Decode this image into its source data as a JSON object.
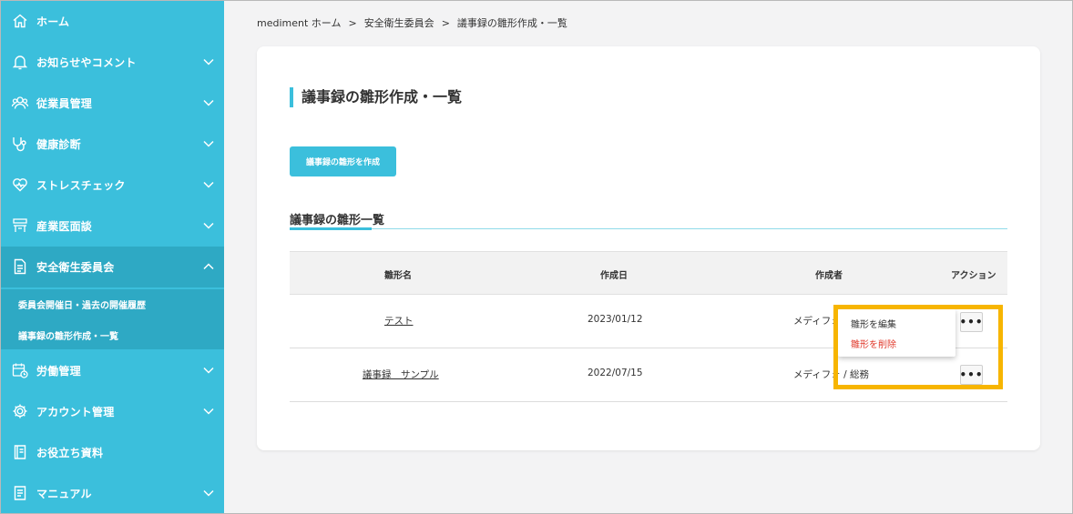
{
  "sidebar": {
    "items": [
      {
        "label": "ホーム",
        "icon": "home-icon",
        "chevron": ""
      },
      {
        "label": "お知らせやコメント",
        "icon": "bell-icon",
        "chevron": "down"
      },
      {
        "label": "従業員管理",
        "icon": "users-icon",
        "chevron": "down"
      },
      {
        "label": "健康診断",
        "icon": "stethoscope-icon",
        "chevron": "down"
      },
      {
        "label": "ストレスチェック",
        "icon": "heart-icon",
        "chevron": "down"
      },
      {
        "label": "産業医面談",
        "icon": "meeting-icon",
        "chevron": "down"
      },
      {
        "label": "安全衛生委員会",
        "icon": "document-icon",
        "chevron": "up"
      },
      {
        "label": "労働管理",
        "icon": "calendar-clock-icon",
        "chevron": "down"
      },
      {
        "label": "アカウント管理",
        "icon": "gear-icon",
        "chevron": "down"
      },
      {
        "label": "お役立ち資料",
        "icon": "book-icon",
        "chevron": ""
      },
      {
        "label": "マニュアル",
        "icon": "manual-icon",
        "chevron": "down"
      }
    ],
    "subitems": [
      {
        "label": "委員会開催日・過去の開催履歴"
      },
      {
        "label": "議事録の雛形作成・一覧"
      }
    ]
  },
  "breadcrumb": {
    "items": [
      "mediment ホーム",
      "安全衛生委員会",
      "議事録の雛形作成・一覧"
    ],
    "separator": ">"
  },
  "main": {
    "title": "議事録の雛形作成・一覧",
    "create_button": "議事録の雛形を作成",
    "section_title": "議事録の雛形一覧",
    "table": {
      "headers": {
        "name": "雛形名",
        "created": "作成日",
        "author": "作成者",
        "action": "アクション"
      },
      "rows": [
        {
          "name": "テスト",
          "created": "2023/01/12",
          "author": "メディフォ"
        },
        {
          "name": "議事録　サンプル",
          "created": "2022/07/15",
          "author": "メディフォ / 総務"
        }
      ],
      "more_label": "•••"
    },
    "dropdown": {
      "edit": "雛形を編集",
      "delete": "雛形を削除"
    }
  },
  "colors": {
    "sidebar": "#3bbfdc",
    "sidebar_active": "#2ea9c4",
    "accent": "#3bbfdc",
    "highlight": "#f7b500",
    "danger": "#e0392b"
  }
}
